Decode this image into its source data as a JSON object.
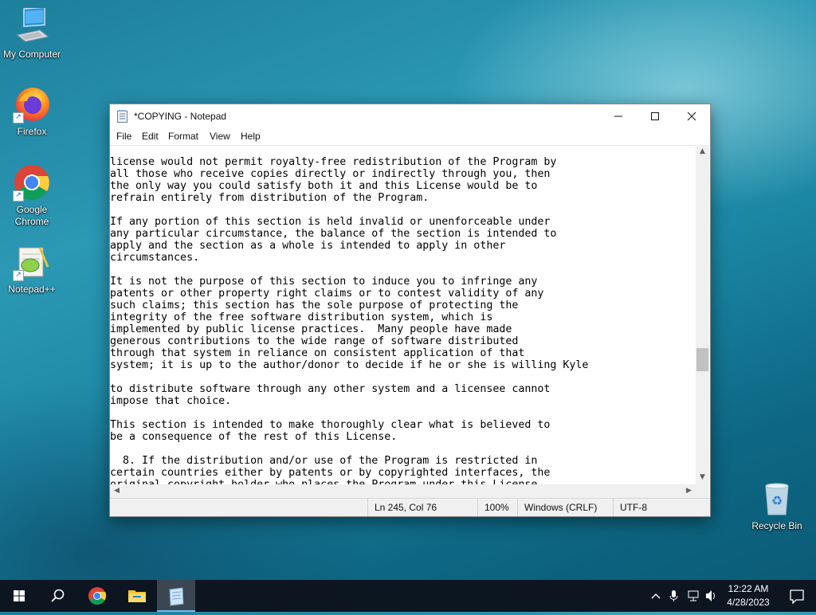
{
  "desktop": {
    "icons": [
      {
        "label": "My Computer"
      },
      {
        "label": "Firefox"
      },
      {
        "label": "Google Chrome"
      },
      {
        "label": "Notepad++"
      },
      {
        "label": "Recycle Bin"
      }
    ]
  },
  "window": {
    "title": "*COPYING - Notepad",
    "menu": [
      "File",
      "Edit",
      "Format",
      "View",
      "Help"
    ],
    "content": "license would not permit royalty-free redistribution of the Program by\nall those who receive copies directly or indirectly through you, then\nthe only way you could satisfy both it and this License would be to\nrefrain entirely from distribution of the Program.\n\nIf any portion of this section is held invalid or unenforceable under\nany particular circumstance, the balance of the section is intended to\napply and the section as a whole is intended to apply in other\ncircumstances.\n\nIt is not the purpose of this section to induce you to infringe any\npatents or other property right claims or to contest validity of any\nsuch claims; this section has the sole purpose of protecting the\nintegrity of the free software distribution system, which is\nimplemented by public license practices.  Many people have made\ngenerous contributions to the wide range of software distributed\nthrough that system in reliance on consistent application of that\nsystem; it is up to the author/donor to decide if he or she is willing Kyle\n\nto distribute software through any other system and a licensee cannot\nimpose that choice.\n\nThis section is intended to make thoroughly clear what is believed to\nbe a consequence of the rest of this License.\n\n  8. If the distribution and/or use of the Program is restricted in\ncertain countries either by patents or by copyrighted interfaces, the\noriginal copyright holder who places the Program under this License",
    "status": {
      "position": "Ln 245, Col 76",
      "zoom": "100%",
      "line_endings": "Windows (CRLF)",
      "encoding": "UTF-8"
    }
  },
  "taskbar": {
    "pinned": [
      "start-icon",
      "search-icon",
      "chrome-icon",
      "file-explorer-icon",
      "notepad-icon"
    ],
    "active": "notepad-icon",
    "clock": {
      "time": "12:22 AM",
      "date": "4/28/2023"
    }
  },
  "colors": {
    "taskbar": "#0d1620",
    "accent": "#76b9ed",
    "wallpaper": "#1b86a3"
  }
}
